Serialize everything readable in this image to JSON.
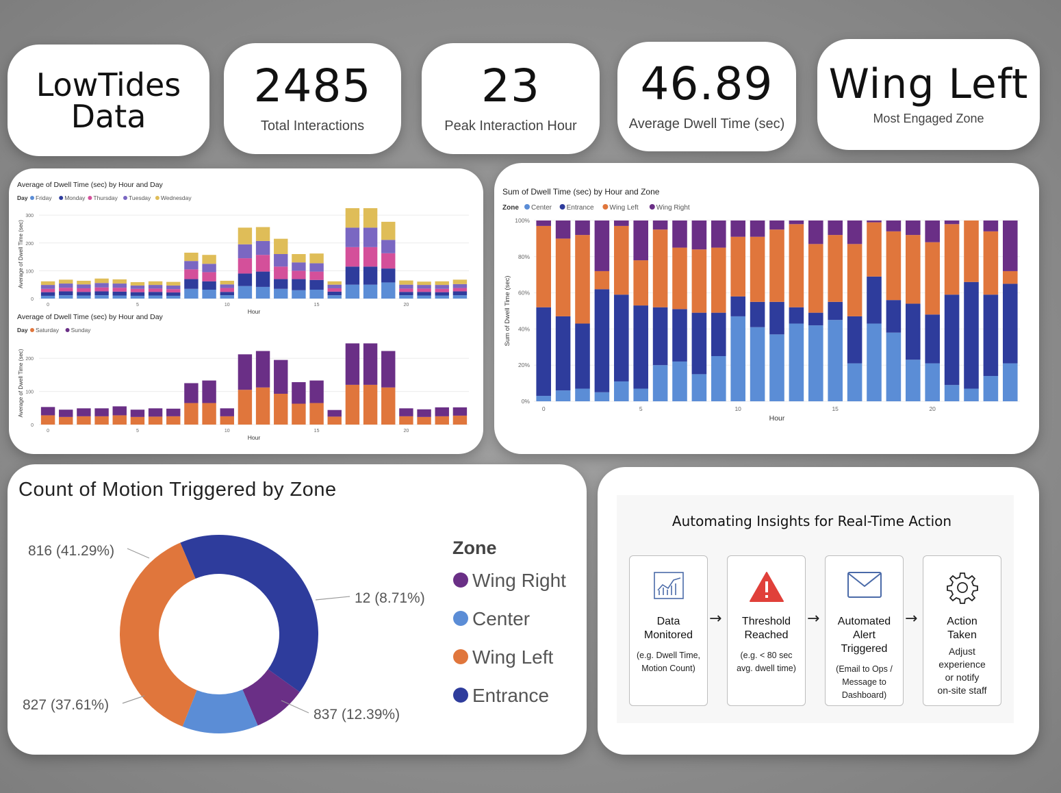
{
  "header": {
    "title_line1": "LowTides",
    "title_line2": "Data"
  },
  "kpis": [
    {
      "value": "2485",
      "label": "Total Interactions"
    },
    {
      "value": "23",
      "label": "Peak Interaction Hour"
    },
    {
      "value": "46.89",
      "label": "Average Dwell Time (sec)"
    },
    {
      "value": "Wing Left",
      "label": "Most Engaged Zone"
    }
  ],
  "chart_data": [
    {
      "type": "bar",
      "stacked": true,
      "title": "Average of Dwell Time (sec) by Hour and Day",
      "legend_title": "Day",
      "xlabel": "Hour",
      "ylabel": "Average of Dwell Time (sec)",
      "x": [
        0,
        1,
        2,
        3,
        4,
        5,
        6,
        7,
        8,
        9,
        10,
        11,
        12,
        13,
        14,
        15,
        16,
        17,
        18,
        19,
        20,
        21,
        22,
        23
      ],
      "x_ticks": [
        "0",
        "5",
        "10",
        "15",
        "20"
      ],
      "y_ticks": [
        "0",
        "100",
        "200",
        "300"
      ],
      "ylim": [
        0,
        320
      ],
      "series": [
        {
          "name": "Friday",
          "color": "#5b8dd6",
          "values": [
            10,
            12,
            11,
            12,
            11,
            10,
            11,
            10,
            35,
            32,
            12,
            45,
            42,
            35,
            30,
            32,
            12,
            50,
            50,
            58,
            12,
            11,
            11,
            12
          ]
        },
        {
          "name": "Monday",
          "color": "#2e3c9c",
          "values": [
            13,
            14,
            13,
            14,
            14,
            13,
            13,
            12,
            35,
            30,
            12,
            45,
            55,
            35,
            40,
            35,
            13,
            65,
            65,
            50,
            12,
            13,
            12,
            14
          ]
        },
        {
          "name": "Thursday",
          "color": "#d4509a",
          "values": [
            12,
            13,
            13,
            14,
            14,
            12,
            12,
            12,
            35,
            33,
            14,
            55,
            60,
            45,
            30,
            30,
            12,
            70,
            70,
            55,
            12,
            12,
            12,
            12
          ]
        },
        {
          "name": "Tuesday",
          "color": "#7a67c2",
          "values": [
            14,
            15,
            14,
            16,
            15,
            12,
            13,
            13,
            30,
            30,
            13,
            50,
            50,
            45,
            30,
            30,
            13,
            70,
            70,
            48,
            14,
            13,
            14,
            14
          ]
        },
        {
          "name": "Wednesday",
          "color": "#dfbd58",
          "values": [
            13,
            14,
            13,
            16,
            15,
            12,
            13,
            13,
            30,
            32,
            13,
            60,
            50,
            55,
            30,
            35,
            12,
            70,
            70,
            65,
            15,
            12,
            13,
            16
          ]
        }
      ]
    },
    {
      "type": "bar",
      "stacked": true,
      "title": "Average of Dwell Time (sec) by Hour and Day",
      "legend_title": "Day",
      "xlabel": "Hour",
      "ylabel": "Average of Dwell Time (sec)",
      "x": [
        0,
        1,
        2,
        3,
        4,
        5,
        6,
        7,
        8,
        9,
        10,
        11,
        12,
        13,
        14,
        15,
        16,
        17,
        18,
        19,
        20,
        21,
        22,
        23
      ],
      "x_ticks": [
        "0",
        "5",
        "10",
        "15",
        "20"
      ],
      "y_ticks": [
        "0",
        "100",
        "200"
      ],
      "ylim": [
        0,
        250
      ],
      "series": [
        {
          "name": "Saturday",
          "color": "#e0763c",
          "values": [
            28,
            23,
            25,
            25,
            28,
            23,
            24,
            25,
            65,
            65,
            25,
            105,
            112,
            93,
            63,
            65,
            24,
            120,
            120,
            112,
            25,
            23,
            25,
            27
          ]
        },
        {
          "name": "Sunday",
          "color": "#6a2f86",
          "values": [
            25,
            22,
            24,
            24,
            27,
            22,
            25,
            23,
            60,
            68,
            24,
            107,
            110,
            102,
            65,
            68,
            20,
            125,
            125,
            110,
            24,
            23,
            27,
            25
          ]
        }
      ]
    },
    {
      "type": "bar",
      "stacked": true,
      "normalized": true,
      "title": "Sum of Dwell Time (sec) by Hour and Zone",
      "legend_title": "Zone",
      "xlabel": "Hour",
      "ylabel": "Sum of Dwell Time (sec)",
      "x": [
        0,
        1,
        2,
        3,
        4,
        5,
        6,
        7,
        8,
        9,
        10,
        11,
        12,
        13,
        14,
        15,
        16,
        17,
        18,
        19,
        20,
        21,
        22,
        23
      ],
      "x_ticks": [
        "0",
        "5",
        "10",
        "15",
        "20"
      ],
      "y_ticks": [
        "0%",
        "20%",
        "40%",
        "60%",
        "80%",
        "100%"
      ],
      "series": [
        {
          "name": "Center",
          "color": "#5b8dd6",
          "values": [
            3,
            6,
            7,
            5,
            11,
            7,
            20,
            22,
            15,
            25,
            47,
            41,
            37,
            43,
            42,
            45,
            21,
            43,
            38,
            23,
            21,
            9,
            7,
            14,
            21
          ]
        },
        {
          "name": "Entrance",
          "color": "#2e3c9c",
          "values": [
            49,
            41,
            36,
            57,
            48,
            46,
            32,
            29,
            34,
            24,
            11,
            14,
            18,
            9,
            7,
            10,
            26,
            26,
            18,
            31,
            27,
            50,
            59,
            45,
            44
          ]
        },
        {
          "name": "Wing Left",
          "color": "#e0763c",
          "values": [
            45,
            43,
            49,
            10,
            38,
            25,
            43,
            34,
            35,
            36,
            33,
            36,
            40,
            46,
            38,
            37,
            40,
            30,
            38,
            38,
            40,
            39,
            34,
            35,
            7
          ]
        },
        {
          "name": "Wing Right",
          "color": "#6a2f86",
          "values": [
            3,
            10,
            8,
            28,
            3,
            22,
            5,
            15,
            16,
            15,
            9,
            9,
            5,
            2,
            13,
            8,
            13,
            1,
            6,
            8,
            12,
            2,
            0,
            6,
            28
          ]
        }
      ]
    },
    {
      "type": "pie",
      "donut": true,
      "title": "Count of Motion Triggered by Zone",
      "legend_title": "Zone",
      "slices": [
        {
          "name": "Entrance",
          "value": 816,
          "label": "816 (41.29%)",
          "color": "#2e3c9c"
        },
        {
          "name": "Wing Right",
          "value": 12,
          "label": "12 (8.71%)",
          "color": "#6a2f86"
        },
        {
          "name": "Center",
          "value": 837,
          "label": "837 (12.39%)",
          "color": "#5b8dd6"
        },
        {
          "name": "Wing Left",
          "value": 827,
          "label": "827 (37.61%)",
          "color": "#e0763c"
        }
      ],
      "legend_order": [
        "Wing Right",
        "Center",
        "Wing Left",
        "Entrance"
      ]
    }
  ],
  "flow": {
    "title": "Automating Insights for Real-Time Action",
    "steps": [
      {
        "icon": "chart-icon",
        "title_lines": [
          "Data",
          "Monitored"
        ],
        "sub_lines": [
          "(e.g. Dwell Time,",
          "Motion Count)"
        ]
      },
      {
        "icon": "warning-icon",
        "title_lines": [
          "Threshold",
          "Reached"
        ],
        "sub_lines": [
          "(e.g. < 80 sec",
          "avg. dwell time)"
        ]
      },
      {
        "icon": "mail-icon",
        "title_lines": [
          "Automated",
          "Alert",
          "Triggered"
        ],
        "sub_lines": [
          "(Email to Ops /",
          "Message to",
          "Dashboard)"
        ]
      },
      {
        "icon": "gear-icon",
        "title_lines": [
          "Action",
          "Taken"
        ],
        "sub_lines": [
          "Adjust",
          "experience",
          "or notify",
          "on-site staff"
        ]
      }
    ],
    "arrow": "→"
  }
}
